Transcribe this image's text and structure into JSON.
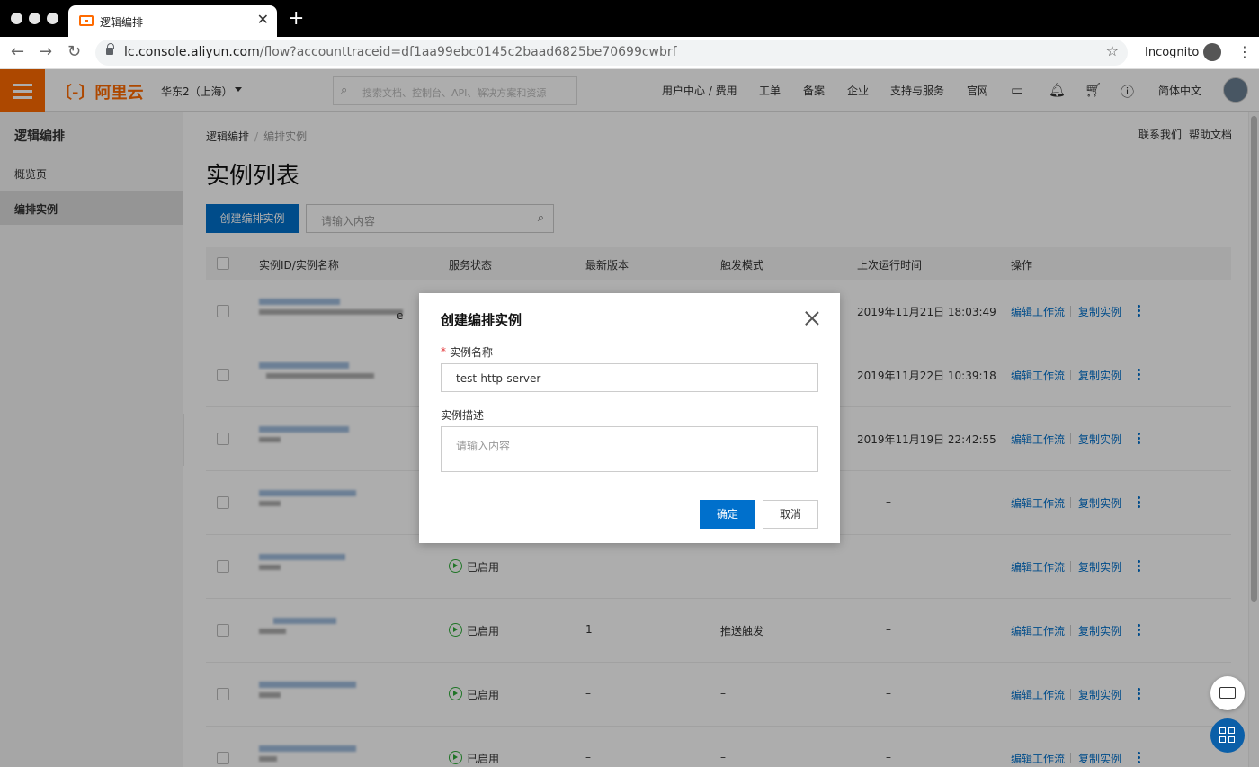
{
  "browser": {
    "tab_title": "逻辑编排",
    "new_tab": "+",
    "url_host": "lc.console.aliyun.com",
    "url_rest": "/flow?accounttraceid=df1aa99ebc0145c2baad6825be70699cwbrf",
    "incognito_label": "Incognito"
  },
  "topbar": {
    "logo": "〔-〕阿里云",
    "region": "华东2（上海）",
    "search_placeholder": "搜索文档、控制台、API、解决方案和资源",
    "nav": [
      "用户中心 / 费用",
      "工单",
      "备案",
      "企业",
      "支持与服务",
      "官网"
    ],
    "language": "简体中文"
  },
  "sidebar": {
    "title": "逻辑编排",
    "items": [
      {
        "label": "概览页"
      },
      {
        "label": "编排实例"
      }
    ]
  },
  "main": {
    "breadcrumb": [
      "逻辑编排",
      "编排实例"
    ],
    "breadcrumb_sep": "/",
    "header_links": [
      "联系我们",
      "帮助文档"
    ],
    "title": "实例列表",
    "create_button": "创建编排实例",
    "filter_placeholder": "请输入内容",
    "columns": [
      "实例ID/实例名称",
      "服务状态",
      "最新版本",
      "触发模式",
      "上次运行时间",
      "操作"
    ],
    "rows": [
      {
        "status": "",
        "version": "",
        "trigger": "",
        "last_run": "2019年11月21日 18:03:49"
      },
      {
        "status": "",
        "version": "",
        "trigger": "",
        "last_run": "2019年11月22日 10:39:18"
      },
      {
        "status": "",
        "version": "",
        "trigger": "",
        "last_run": "2019年11月19日 22:42:55"
      },
      {
        "status": "",
        "version": "",
        "trigger": "",
        "last_run": "–"
      },
      {
        "status": "已启用",
        "version": "–",
        "trigger": "–",
        "last_run": "–"
      },
      {
        "status": "已启用",
        "version": "1",
        "trigger": "推送触发",
        "last_run": "–"
      },
      {
        "status": "已启用",
        "version": "–",
        "trigger": "–",
        "last_run": "–"
      },
      {
        "status": "已启用",
        "version": "–",
        "trigger": "–",
        "last_run": "–"
      }
    ],
    "op_edit": "编辑工作流",
    "op_copy": "复制实例",
    "row1_suffix": "e"
  },
  "modal": {
    "title": "创建编排实例",
    "required_mark": "*",
    "name_label": "实例名称",
    "name_value": "test-http-server",
    "desc_label": "实例描述",
    "desc_placeholder": "请输入内容",
    "ok": "确定",
    "cancel": "取消"
  },
  "colors": {
    "brand": "#ff6a00",
    "primary": "#0070cc",
    "status_green": "#2eac39"
  }
}
